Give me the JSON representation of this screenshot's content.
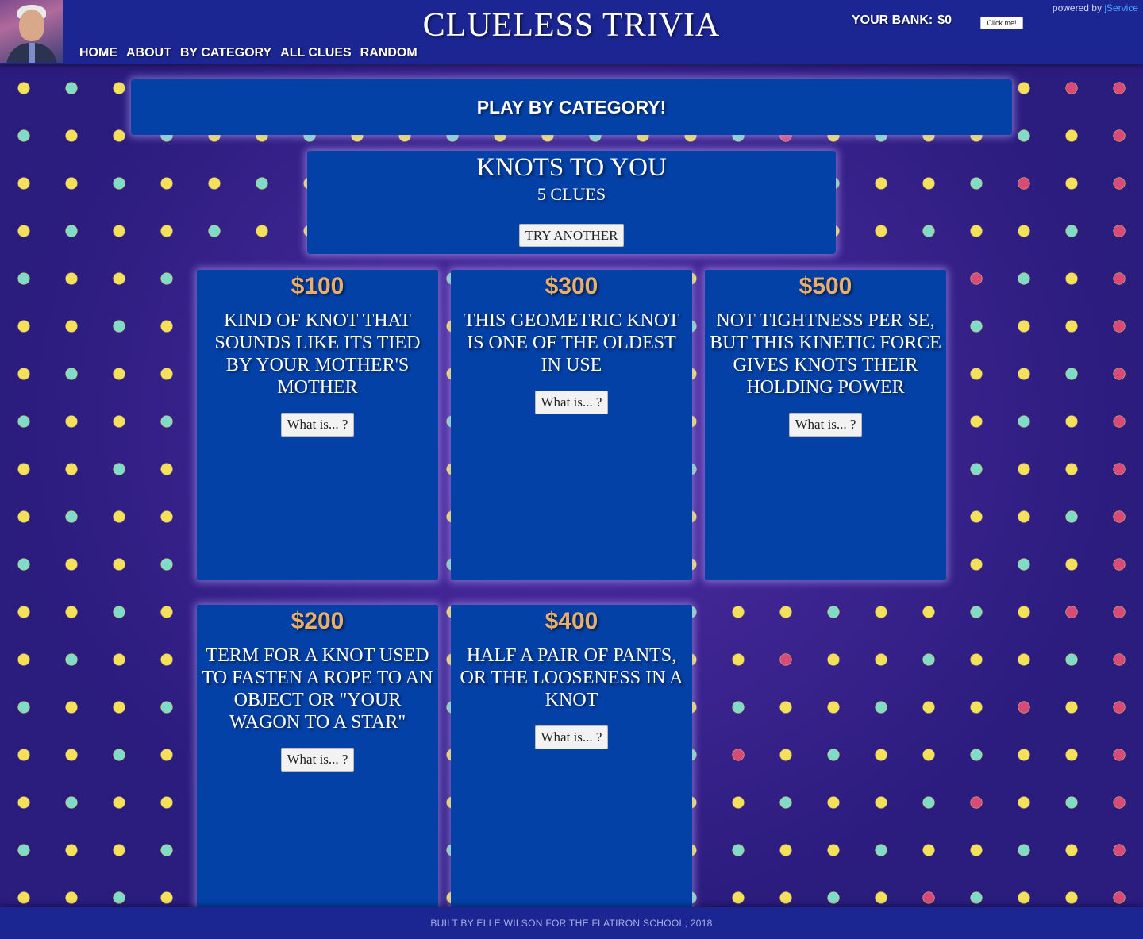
{
  "header": {
    "title": "CLUELESS TRIVIA",
    "nav": [
      "HOME",
      "ABOUT",
      "BY CATEGORY",
      "ALL CLUES",
      "RANDOM"
    ],
    "bank_label": "YOUR BANK:",
    "bank_amount": "$0",
    "click_label": "Click me!",
    "powered_prefix": "powered by",
    "powered_link": "jService"
  },
  "banner": {
    "title": "PLAY BY CATEGORY!"
  },
  "category": {
    "title": "KNOTS TO YOU",
    "count": "5 CLUES",
    "try_label": "TRY ANOTHER"
  },
  "clues": [
    {
      "value": "$100",
      "question": "Kind of knot that sounds like its tied by your mother's mother",
      "answer_label": "What is... ?"
    },
    {
      "value": "$300",
      "question": "This geometric knot is one of the oldest in use",
      "answer_label": "What is... ?"
    },
    {
      "value": "$500",
      "question": "Not tightness per se, but this kinetic force gives knots their holding power",
      "answer_label": "What is... ?"
    },
    {
      "value": "$200",
      "question": "Term for a knot used to fasten a rope to an object or \"your wagon to a star\"",
      "answer_label": "What is... ?"
    },
    {
      "value": "$400",
      "question": "Half a pair of pants, or the looseness in a knot",
      "answer_label": "What is... ?"
    }
  ],
  "footer": {
    "text": "BUILT BY ELLE WILSON FOR THE FLATIRON SCHOOL, 2018"
  },
  "colors": {
    "background": "#3a2590",
    "header": "#1c2693",
    "card": "#0441a7",
    "value": "#e7ae6c",
    "dot_yellow": "#f5e05a",
    "dot_teal": "#7fdcc8",
    "dot_pink": "#d94a7a"
  }
}
